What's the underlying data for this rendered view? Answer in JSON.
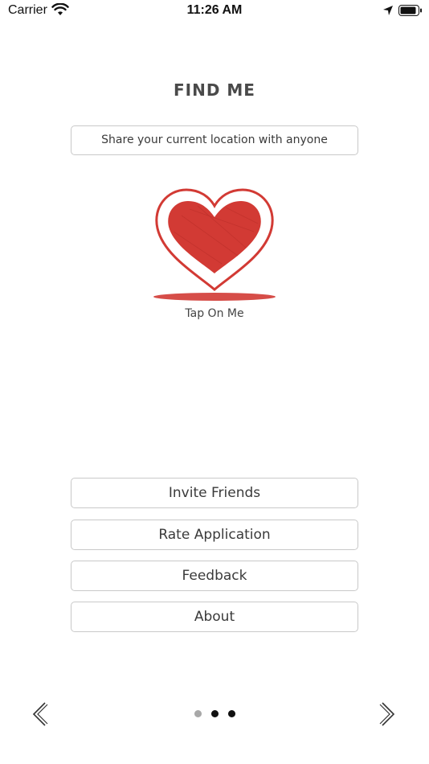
{
  "status_bar": {
    "carrier": "Carrier",
    "time": "11:26 AM",
    "icons": [
      "wifi-icon",
      "location-arrow-icon",
      "battery-icon"
    ]
  },
  "page": {
    "title": "FIND ME",
    "share_button_label": "Share your current location with anyone",
    "heart_icon": "heart-icon",
    "tap_label": "Tap On Me"
  },
  "menu": {
    "items": [
      {
        "label": "Invite Friends"
      },
      {
        "label": "Rate Application"
      },
      {
        "label": "Feedback"
      },
      {
        "label": "About"
      }
    ]
  },
  "pager": {
    "prev_icon": "chevron-left-icon",
    "next_icon": "chevron-right-icon",
    "page_count": 3,
    "current_page": 2
  },
  "colors": {
    "heart_red": "#d23a34",
    "border_gray": "#c9c9c9",
    "text_dark": "#3a3a3a"
  }
}
